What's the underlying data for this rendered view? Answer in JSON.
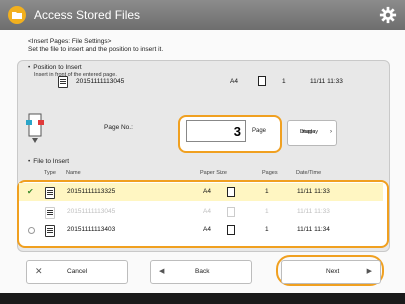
{
  "window": {
    "title": "Access Stored Files"
  },
  "header": {
    "line1": "<Insert Pages: File Settings>",
    "line2": "Set the file to insert and the position to insert it."
  },
  "position_section": {
    "title": "Position to Insert",
    "subtitle": "Insert in front of the entered page.",
    "row": {
      "name": "20151111113045",
      "size": "A4",
      "pages": "1",
      "date": "11/11 11:33"
    }
  },
  "page_no": {
    "label": "Page No.:",
    "value": "3",
    "unit": "Page",
    "display_button": [
      "Display",
      "Image"
    ]
  },
  "file_section": {
    "title": "File to Insert",
    "columns": [
      "Type",
      "Name",
      "Paper Size",
      "Pages",
      "Date/Time"
    ],
    "rows": [
      {
        "name": "20151111113325",
        "size": "A4",
        "pages": "1",
        "date": "11/11 11:33",
        "state": "selected"
      },
      {
        "name": "20151111113045",
        "size": "A4",
        "pages": "1",
        "date": "11/11 11:33",
        "state": "disabled"
      },
      {
        "name": "20151111113403",
        "size": "A4",
        "pages": "1",
        "date": "11/11 11:34",
        "state": "normal"
      }
    ]
  },
  "buttons": {
    "cancel": "Cancel",
    "back": "Back",
    "next": "Next"
  },
  "colors": {
    "accent": "#f0a020",
    "title_bar": "#7a7a7a",
    "selected_row": "#fff6c2"
  }
}
